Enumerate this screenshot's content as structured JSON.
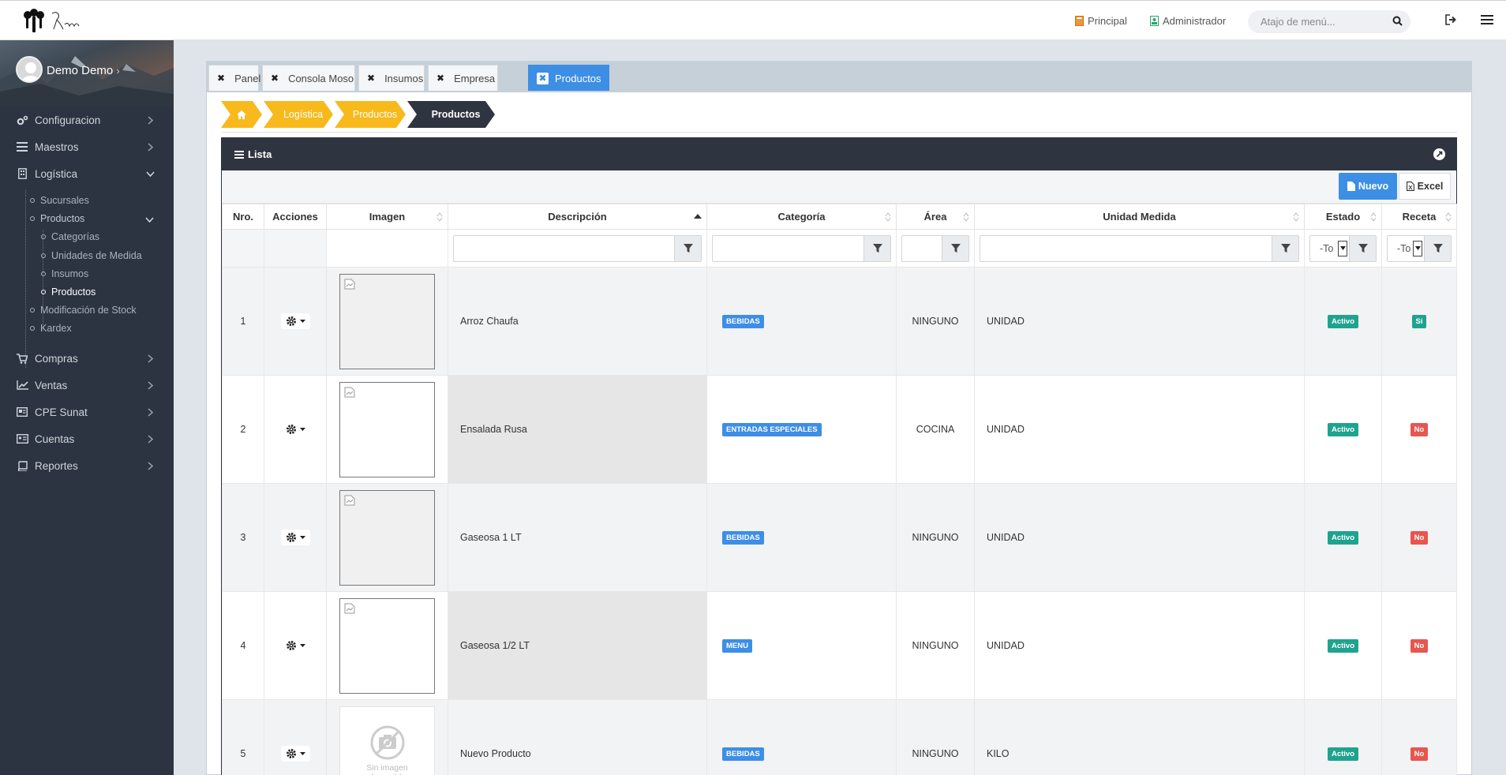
{
  "topbar": {
    "principal": "Principal",
    "administrador": "Administrador",
    "search_placeholder": "Atajo de menú...",
    "colors": {
      "principal_icon": "#f0953a",
      "admin_icon": "#2aa36b"
    }
  },
  "sidebar": {
    "user_name": "Demo Demo",
    "items": [
      {
        "label": "Configuracion",
        "icon": "gears-icon"
      },
      {
        "label": "Maestros",
        "icon": "list-icon"
      },
      {
        "label": "Logística",
        "icon": "building-icon"
      },
      {
        "label": "Compras",
        "icon": "cart-icon"
      },
      {
        "label": "Ventas",
        "icon": "line-chart-icon"
      },
      {
        "label": "CPE Sunat",
        "icon": "document-icon"
      },
      {
        "label": "Cuentas",
        "icon": "card-icon"
      },
      {
        "label": "Reportes",
        "icon": "book-icon"
      }
    ],
    "logistica_sub": [
      "Sucursales",
      "Productos",
      "Modificación de Stock",
      "Kardex"
    ],
    "productos_sub": [
      "Categorías",
      "Unidades de Medida",
      "Insumos",
      "Productos"
    ]
  },
  "tabs": [
    "Panel",
    "Consola Moso",
    "Insumos",
    "Empresa",
    "Productos"
  ],
  "breadcrumb": [
    "Logística",
    "Productos",
    "Productos"
  ],
  "panel": {
    "title": "Lista",
    "new_button": "Nuevo",
    "excel_button": "Excel"
  },
  "table": {
    "headers": [
      "Nro.",
      "Acciones",
      "Imagen",
      "Descripción",
      "Categoría",
      "Área",
      "Unidad Medida",
      "Estado",
      "Receta"
    ],
    "filter_select": "-To",
    "no_image_text": "Sin imagen disponible",
    "rows": [
      {
        "nro": "1",
        "descripcion": "Arroz Chaufa",
        "categoria": "BEBIDAS",
        "area": "NINGUNO",
        "unidad": "UNIDAD",
        "estado": "Activo",
        "receta": "Si"
      },
      {
        "nro": "2",
        "descripcion": "Ensalada Rusa",
        "categoria": "ENTRADAS ESPECIALES",
        "area": "COCINA",
        "unidad": "UNIDAD",
        "estado": "Activo",
        "receta": "No"
      },
      {
        "nro": "3",
        "descripcion": "Gaseosa 1 LT",
        "categoria": "BEBIDAS",
        "area": "NINGUNO",
        "unidad": "UNIDAD",
        "estado": "Activo",
        "receta": "No"
      },
      {
        "nro": "4",
        "descripcion": "Gaseosa 1/2 LT",
        "categoria": "MENU",
        "area": "NINGUNO",
        "unidad": "UNIDAD",
        "estado": "Activo",
        "receta": "No"
      },
      {
        "nro": "5",
        "descripcion": "Nuevo Producto",
        "categoria": "BEBIDAS",
        "area": "NINGUNO",
        "unidad": "KILO",
        "estado": "Activo",
        "receta": "No"
      }
    ]
  }
}
